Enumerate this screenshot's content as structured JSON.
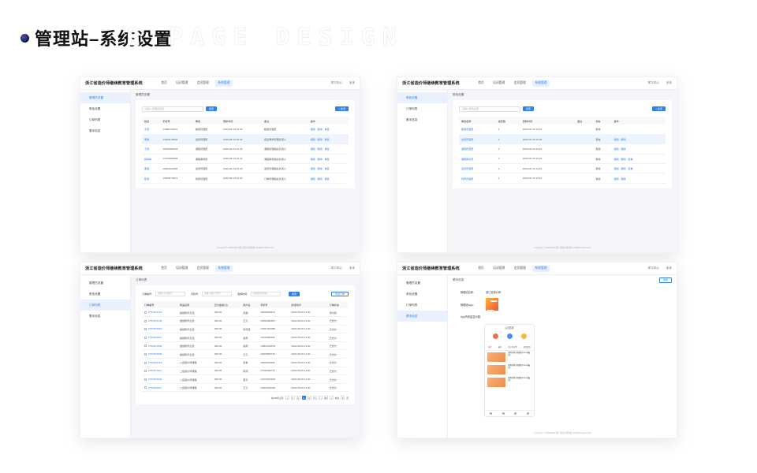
{
  "header": {
    "title": "管理站–系统设置",
    "watermark": "E PAGE DESIGN"
  },
  "app": {
    "name": "浙江省造价师继续教育管理系统",
    "nav": [
      "首页",
      "培训管理",
      "会员管理",
      "系统管理"
    ],
    "top_right": [
      "学习中心",
      "手手"
    ],
    "footer": "Copyright © 2008-2020 浙江省造价师协会 All Rights Reserved"
  },
  "sidebar": [
    "管理员设置",
    "角色设置",
    "订单列表",
    "基本信息"
  ],
  "panel1": {
    "crumb": "管理员设置",
    "search_placeholder": "请输入管理员姓名",
    "search_btn": "搜索",
    "add_btn": "+ 新增",
    "columns": [
      "姓名",
      "手机号",
      "角色",
      "更新时间",
      "备注",
      "操作"
    ],
    "rows": [
      [
        "王晓",
        "13086703297",
        "超级管理员",
        "2019-06-15 10:23",
        "超级管理员",
        "编辑 · 删除 · 重置"
      ],
      [
        "李娟",
        "14329178902",
        "会员管理员",
        "2019-06-15 10:23",
        "招生教学管理负责人",
        "编辑 · 删除 · 重置"
      ],
      [
        "王伟",
        "15342093078",
        "课程管理员",
        "2019-06-15 10:23",
        "课程管理相关负责人",
        "编辑 · 删除 · 重置"
      ],
      [
        "顾婷婷",
        "17013026983",
        "课程审核员",
        "2019-06-15 10:23",
        "课程审核相关负责人",
        "编辑 · 删除 · 重置"
      ],
      [
        "董森",
        "18401821806",
        "会员管理员",
        "2019-06-15 10:23",
        "会员管理相关负责人",
        "编辑 · 删除 · 重置"
      ],
      [
        "陈雨",
        "14463172872",
        "财务管理员",
        "2019-06-15 10:23",
        "订单管理相关负责人",
        "编辑 · 删除 · 重置"
      ]
    ]
  },
  "panel2": {
    "crumb": "角色设置",
    "search_placeholder": "请输入角色名称",
    "search_btn": "搜索",
    "add_btn": "+ 新增",
    "columns": [
      "角色名称",
      "成员数",
      "更新时间",
      "备注",
      "状态",
      "操作"
    ],
    "rows": [
      [
        "超级管理员",
        "1",
        "2019-06-15 10:23",
        "",
        "有效",
        ""
      ],
      [
        "会员管理员",
        "2",
        "2019-06-15 10:23",
        "",
        "有效",
        "编辑 · 删除"
      ],
      [
        "课程管理员",
        "1",
        "2019-06-15 10:23",
        "",
        "有效",
        "编辑 · 删除"
      ],
      [
        "课程审核员",
        "0",
        "2019-06-15 10:23",
        "",
        "有效",
        "编辑 · 删除 · 查看"
      ],
      [
        "会员管理员",
        "1",
        "2019-06-15 10:23",
        "",
        "有效",
        "编辑 · 删除 · 查看"
      ],
      [
        "财务管理员",
        "1",
        "2019-06-15 10:23",
        "",
        "有效",
        "编辑 · 删除"
      ]
    ]
  },
  "panel3": {
    "crumb": "订单列表",
    "filter_labels": [
      "订单编号：",
      "手机号：",
      "选择时间："
    ],
    "filter_placeholders": [
      "请输入订单编号",
      "请输入用户手机号",
      "请选择时间范围"
    ],
    "search_btn": "搜索",
    "export_btn": "导出订单",
    "columns": [
      "订单编号",
      "商品名称",
      "应付金额(元)",
      "用户名",
      "手机号",
      "创建时间",
      "订单状态"
    ],
    "rows": [
      [
        "2754874744",
        "继续教育全选",
        "300.00",
        "周超",
        "18638918671",
        "2019-05-05 11:00",
        "待付款"
      ],
      [
        "2754875138",
        "继续教育全选",
        "300.00",
        "王元",
        "15652386987",
        "2019-05-05 11:00",
        "已支付"
      ],
      [
        "2754875964",
        "继续教育全选",
        "300.00",
        "周伟真",
        "13457323086",
        "2019-05-05 11:00",
        "已支付"
      ],
      [
        "2754875007",
        "继续教育全选",
        "300.00",
        "赵梓",
        "13016968681",
        "2019-05-05 11:00",
        "已支付"
      ],
      [
        "2754871584",
        "继续教育全选",
        "300.00",
        "赵雨",
        "13863708978",
        "2019-05-05 11:00",
        "已支付"
      ],
      [
        "2754875509",
        "继续教育全选",
        "300.00",
        "王元",
        "18409685761",
        "2019-05-05 11:00",
        "已支付"
      ],
      [
        "2754875419",
        "二级造价师课程",
        "300.00",
        "张孝",
        "18650539981",
        "2019-05-05 11:00",
        "已支付"
      ],
      [
        "2754871014",
        "二级造价师课程",
        "300.00",
        "陈伟",
        "17530360737",
        "2019-05-05 11:00",
        "已支付"
      ],
      [
        "2754875993",
        "二级造价师课程",
        "300.00",
        "董平",
        "14073816900",
        "2019-05-05 11:00",
        "已支付"
      ],
      [
        "2754875037",
        "二级造价师课程",
        "300.00",
        "王元",
        "13463318336",
        "2019-05-05 11:00",
        "已支付"
      ]
    ],
    "pagination": {
      "total_label": "共638条记录",
      "pages": [
        "1",
        "2",
        "3",
        "4",
        "5",
        "…",
        "60"
      ],
      "active": "3",
      "goto_label": "前往",
      "goto_value": "5",
      "page_suffix": "页"
    }
  },
  "panel4": {
    "crumb": "基本信息",
    "edit_btn": "编辑",
    "fields": [
      {
        "k": "管理站名称：",
        "v": "浙江省造价师"
      },
      {
        "k": "管理站logo：",
        "v": ""
      },
      {
        "k": "App内资金显示图：",
        "v": ""
      }
    ],
    "phone": {
      "title": "公司首页",
      "tabs": [
        "推荐",
        "最新",
        "造价师课程",
        "继续教育"
      ],
      "courses": [
        "课程名称示例课程(2019年最新)",
        "课程名称示例课程(2019年最新)",
        "课程名称示例课程(2019年最新)"
      ]
    }
  }
}
